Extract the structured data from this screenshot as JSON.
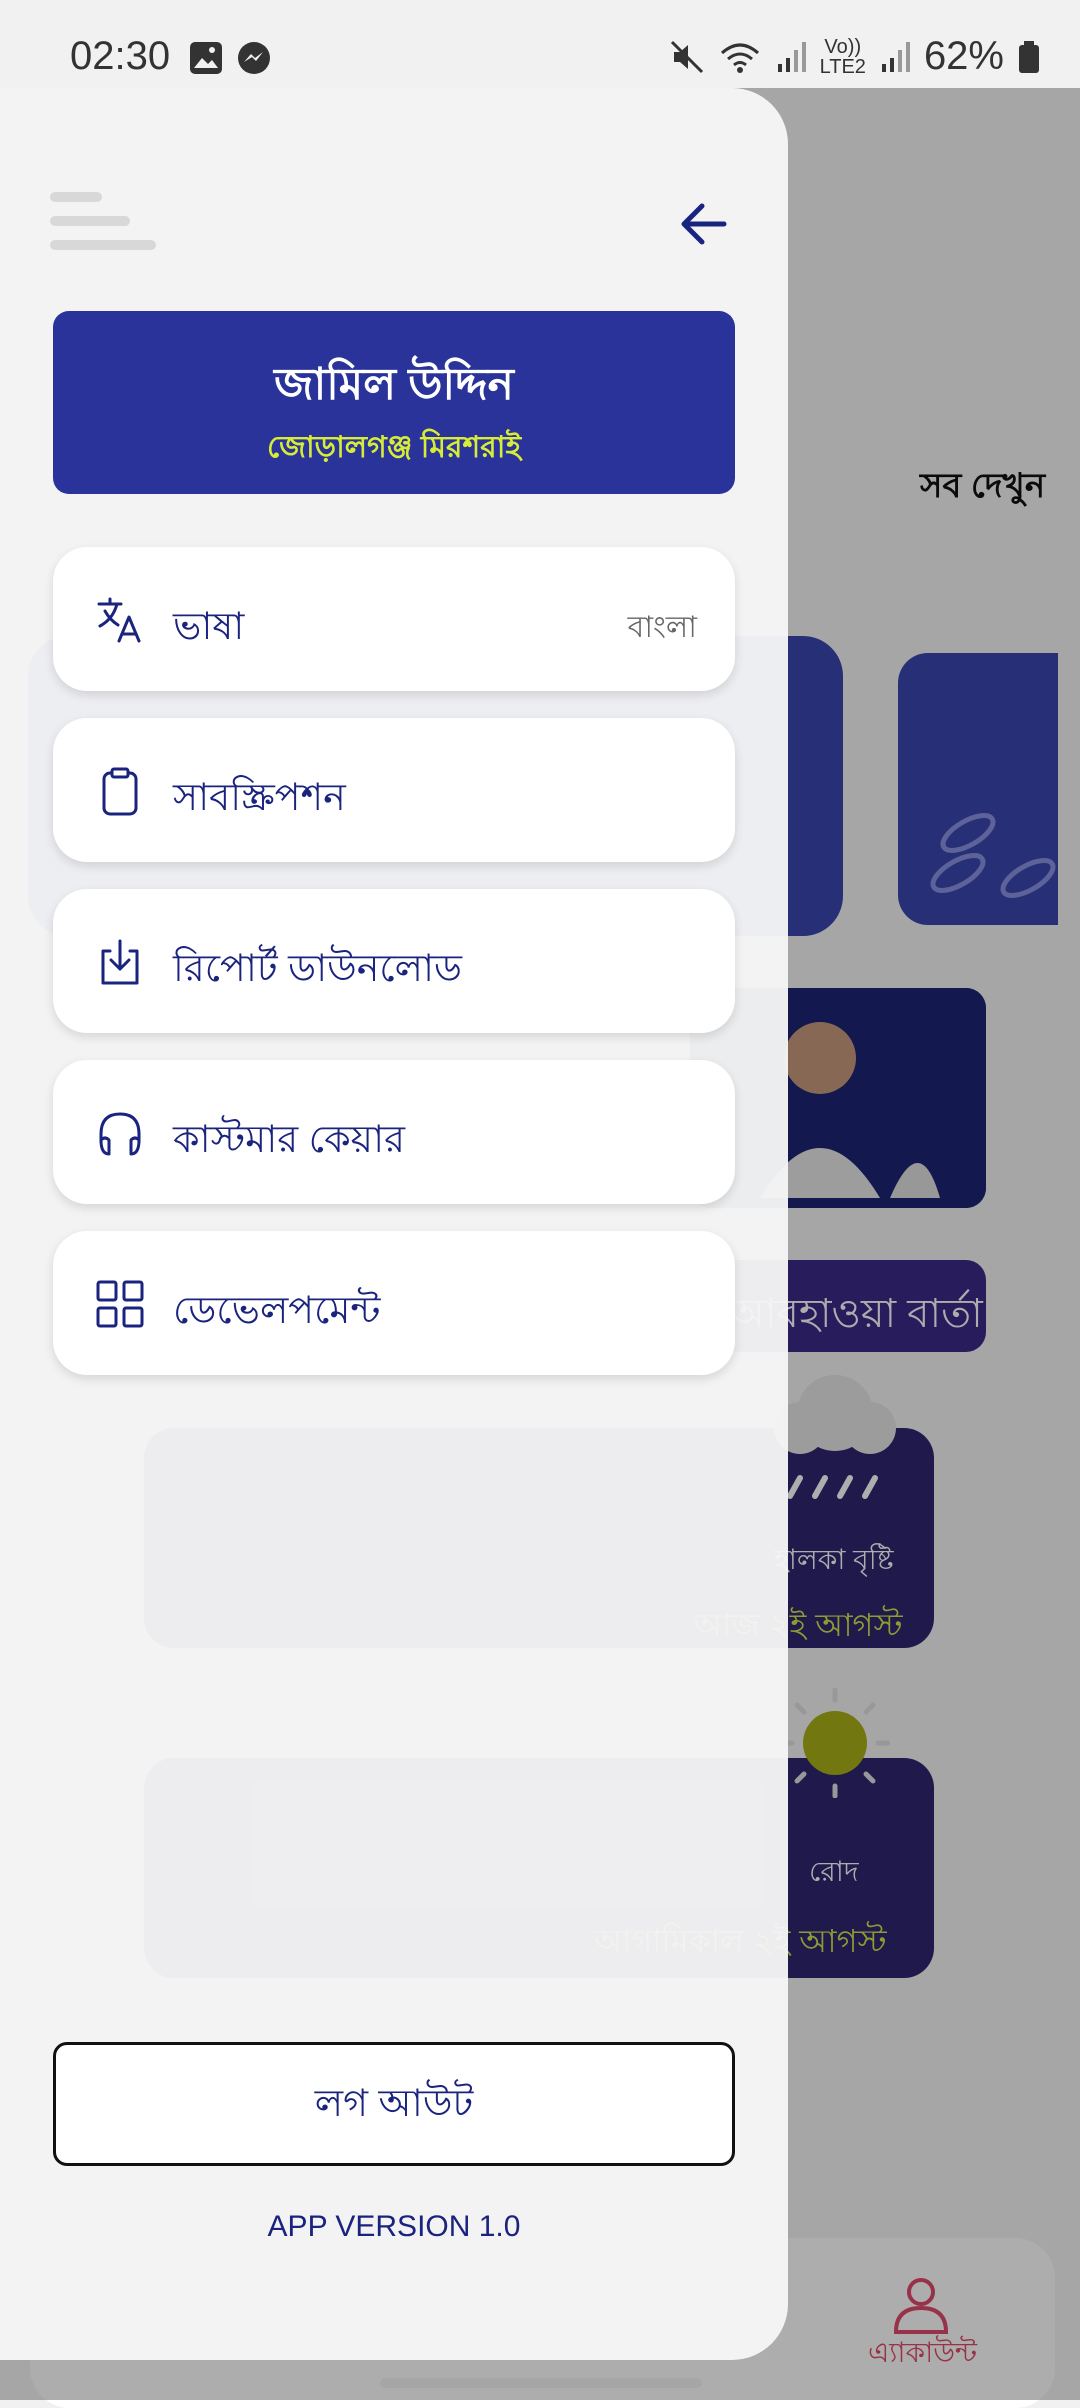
{
  "status_bar": {
    "time": "02:30",
    "battery": "62%",
    "network_label_top": "Vo))",
    "network_label_bottom": "LTE2"
  },
  "drawer": {
    "profile": {
      "name": "জামিল উদ্দিন",
      "location": "জোড়ালগঞ্জ মিরশরাই"
    },
    "menu_items": [
      {
        "label": "ভাষা",
        "value": "বাংলা",
        "icon": "translate-icon"
      },
      {
        "label": "সাবস্ক্রিপশন",
        "icon": "clipboard-icon"
      },
      {
        "label": "রিপোর্ট ডাউনলোড",
        "icon": "download-icon"
      },
      {
        "label": "কাস্টমার কেয়ার",
        "icon": "headphones-icon"
      },
      {
        "label": "ডেভেলপমেন্ট",
        "icon": "grid-icon"
      }
    ],
    "logout_label": "লগ আউট",
    "version": "APP VERSION 1.0"
  },
  "background": {
    "see_all": "সব দেখুন",
    "weather_title": "আবহাওয়া বার্তা",
    "weather_cards": [
      {
        "condition": "হালকা বৃষ্টি",
        "date": "আজ ২ই আগস্ট"
      },
      {
        "condition": "রোদ",
        "date": "আগামিকাল ২ই আগস্ট"
      }
    ],
    "bottom_nav_account": "এ্যাকাউন্ট"
  },
  "colors": {
    "primary": "#29339a",
    "accent_yellow": "#d7ec35",
    "text_navy": "#1a237e"
  }
}
